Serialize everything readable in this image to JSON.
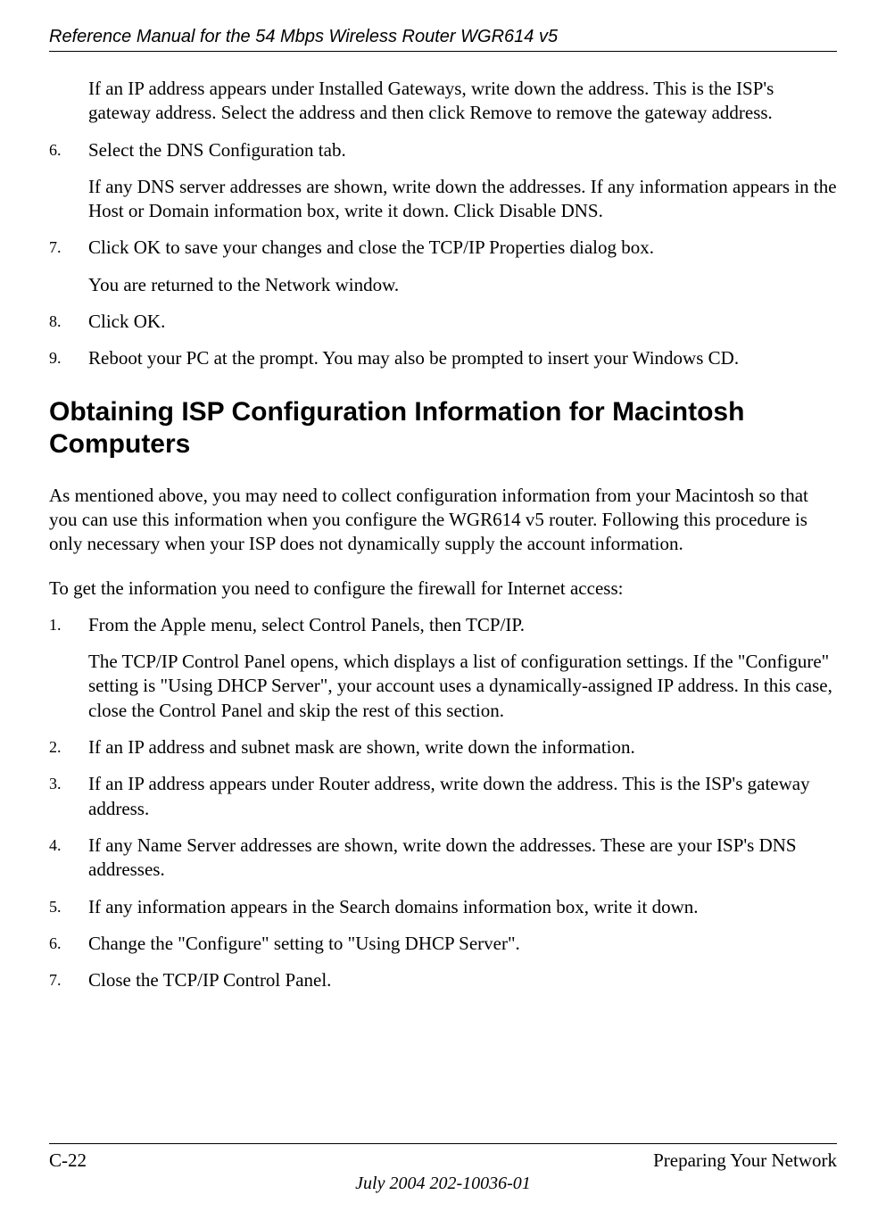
{
  "header": {
    "title": "Reference Manual for the 54 Mbps Wireless Router WGR614 v5"
  },
  "content": {
    "para_prev": "If an IP address appears under Installed Gateways, write down the address. This is the ISP's gateway address. Select the address and then click Remove to remove the gateway address.",
    "step6": {
      "marker": "6.",
      "line1": "Select the DNS Configuration tab.",
      "line2": "If any DNS server addresses are shown, write down the addresses. If any information appears in the Host or Domain information box, write it down. Click Disable DNS."
    },
    "step7": {
      "marker": "7.",
      "line1": "Click OK to save your changes and close the TCP/IP Properties dialog box.",
      "line2": "You are returned to the Network window."
    },
    "step8": {
      "marker": "8.",
      "line1": "Click OK."
    },
    "step9": {
      "marker": "9.",
      "line1": "Reboot your PC at the prompt. You may also be prompted to insert your Windows CD."
    },
    "heading": "Obtaining ISP Configuration Information for Macintosh Computers",
    "intro": "As mentioned above, you may need to collect configuration information from your Macintosh so that you can use this information when you configure the WGR614 v5 router. Following this procedure is only necessary when your ISP does not dynamically supply the account information.",
    "instruction": "To get the information you need to configure the firewall for Internet access:",
    "mac_step1": {
      "marker": "1.",
      "line1": "From the Apple menu, select Control Panels, then TCP/IP.",
      "line2": "The TCP/IP Control Panel opens, which displays a list of configuration settings. If the \"Configure\" setting is \"Using DHCP Server\", your account uses a dynamically-assigned IP address. In this case, close the Control Panel and skip the rest of this section."
    },
    "mac_step2": {
      "marker": "2.",
      "line1": "If an IP address and subnet mask are shown, write down the information."
    },
    "mac_step3": {
      "marker": "3.",
      "line1": "If an IP address appears under Router address, write down the address. This is the ISP's gateway address."
    },
    "mac_step4": {
      "marker": "4.",
      "line1": "If any Name Server addresses are shown, write down the addresses. These are your ISP's DNS addresses."
    },
    "mac_step5": {
      "marker": "5.",
      "line1": "If any information appears in the Search domains information box, write it down."
    },
    "mac_step6": {
      "marker": "6.",
      "line1": "Change the \"Configure\" setting to \"Using DHCP Server\"."
    },
    "mac_step7": {
      "marker": "7.",
      "line1": "Close the TCP/IP Control Panel."
    }
  },
  "footer": {
    "page_number": "C-22",
    "section_name": "Preparing Your Network",
    "date_line": "July 2004 202-10036-01"
  }
}
